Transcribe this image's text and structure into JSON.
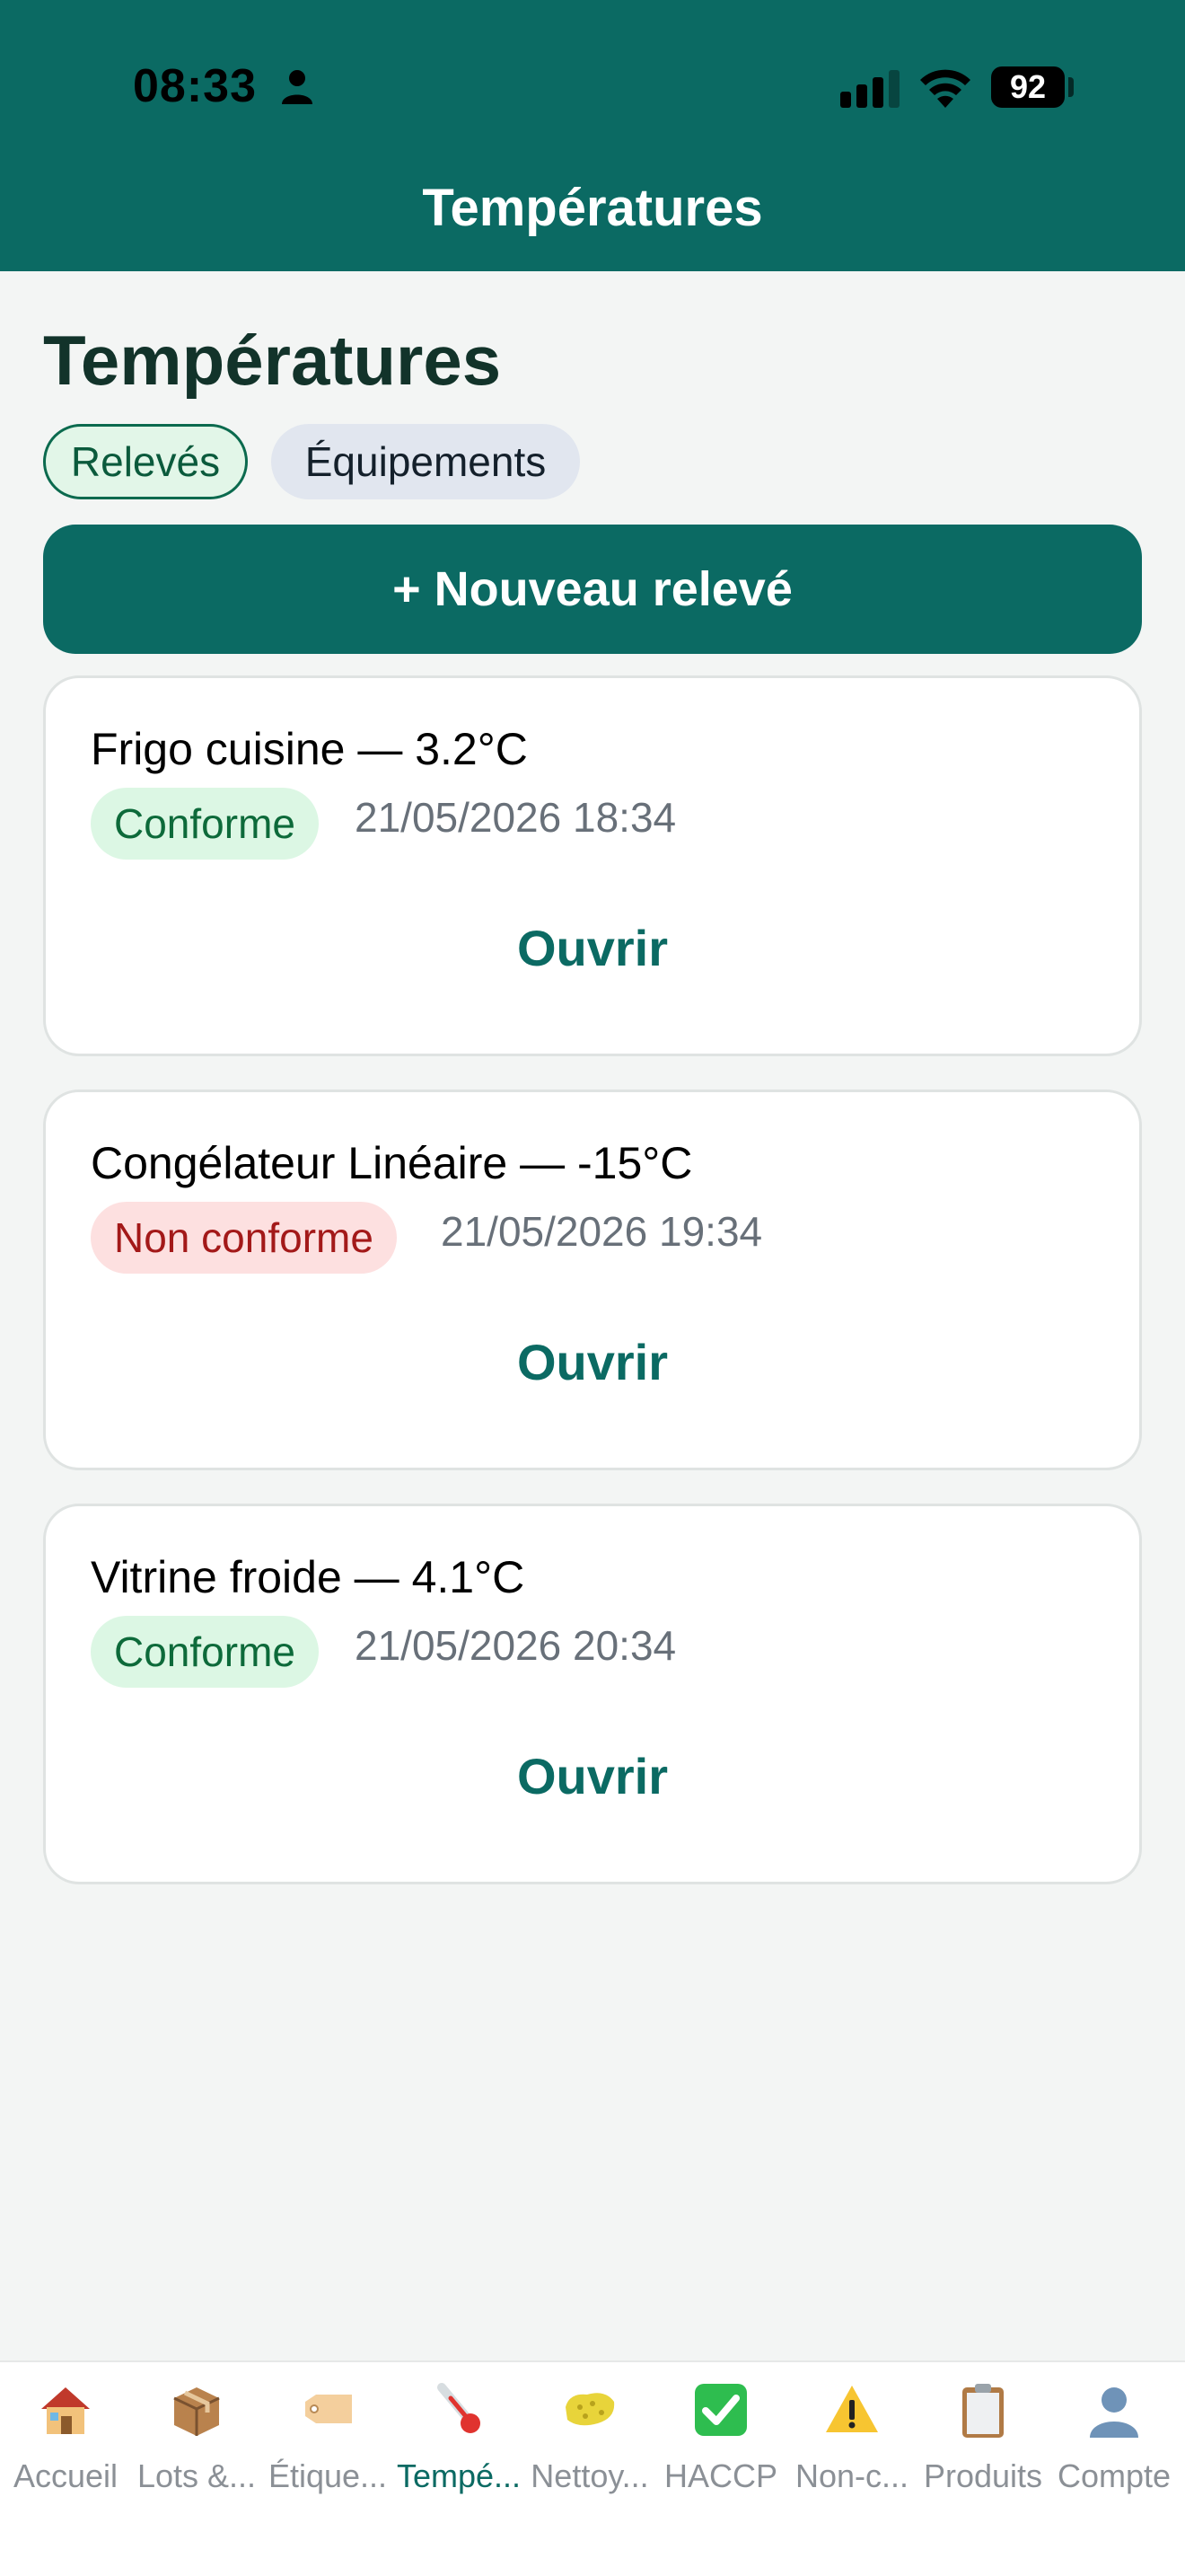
{
  "status_bar": {
    "time": "08:33",
    "battery": "92"
  },
  "header": {
    "title": "Températures"
  },
  "page": {
    "title": "Températures",
    "segments": [
      {
        "label": "Relevés",
        "active": true
      },
      {
        "label": "Équipements",
        "active": false
      }
    ],
    "new_button_label": "+ Nouveau relevé"
  },
  "readings": [
    {
      "title": "Frigo cuisine — 3.2°C",
      "status": "Conforme",
      "compliant": true,
      "date": "21/05/2026 18:34",
      "action": "Ouvrir"
    },
    {
      "title": "Congélateur Linéaire — -15°C",
      "status": "Non conforme",
      "compliant": false,
      "date": "21/05/2026 19:34",
      "action": "Ouvrir"
    },
    {
      "title": "Vitrine froide — 4.1°C",
      "status": "Conforme",
      "compliant": true,
      "date": "21/05/2026 20:34",
      "action": "Ouvrir"
    }
  ],
  "tabbar": [
    {
      "label": "Accueil",
      "icon": "house-icon",
      "active": false
    },
    {
      "label": "Lots &...",
      "icon": "package-icon",
      "active": false
    },
    {
      "label": "Étique...",
      "icon": "tag-icon",
      "active": false
    },
    {
      "label": "Tempé...",
      "icon": "thermometer-icon",
      "active": true
    },
    {
      "label": "Nettoy...",
      "icon": "sponge-icon",
      "active": false
    },
    {
      "label": "HACCP",
      "icon": "check-icon",
      "active": false
    },
    {
      "label": "Non-c...",
      "icon": "warning-icon",
      "active": false
    },
    {
      "label": "Produits",
      "icon": "clipboard-icon",
      "active": false
    },
    {
      "label": "Compte",
      "icon": "user-icon",
      "active": false
    }
  ],
  "colors": {
    "brand": "#0b6a63",
    "ok_bg": "#dcf7e4",
    "ok_text": "#0d6a3a",
    "ko_bg": "#fde0e0",
    "ko_text": "#a31919"
  }
}
